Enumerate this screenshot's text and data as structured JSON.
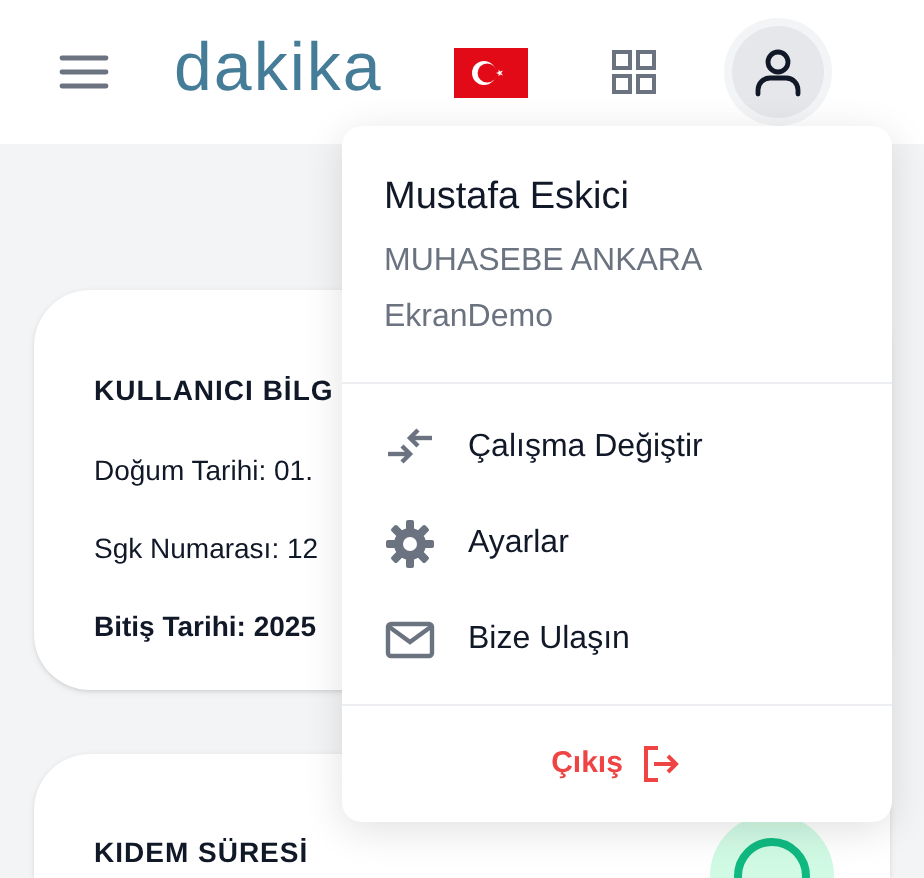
{
  "header": {
    "logo": "dakika"
  },
  "user_card": {
    "title": "KULLANICI BİLG",
    "lines": [
      {
        "text": "Doğum Tarihi: 01.",
        "bold": false
      },
      {
        "text": "Sgk Numarası: 12",
        "bold": false
      },
      {
        "text": "Bitiş Tarihi: 2025",
        "bold": true
      }
    ]
  },
  "seniority_card": {
    "title": "KIDEM SÜRESİ"
  },
  "profile_menu": {
    "name": "Mustafa Eskici",
    "department": "MUHASEBE ANKARA",
    "company": "EkranDemo",
    "items": [
      {
        "kind": "switch",
        "label": "Çalışma Değiştir"
      },
      {
        "kind": "settings",
        "label": "Ayarlar"
      },
      {
        "kind": "mail",
        "label": "Bize Ulaşın"
      }
    ],
    "logout": "Çıkış"
  }
}
